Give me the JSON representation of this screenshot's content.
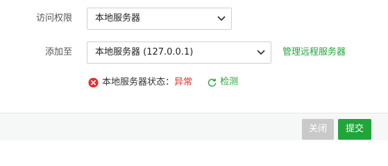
{
  "form": {
    "access": {
      "label": "访问权限",
      "selected": "本地服务器"
    },
    "add_to": {
      "label": "添加至",
      "selected": "本地服务器 (127.0.0.1)",
      "manage_link": "管理远程服务器"
    },
    "status": {
      "label": "本地服务器状态：",
      "value": "异常",
      "detect_label": "检测"
    }
  },
  "footer": {
    "close_label": "关闭",
    "submit_label": "提交"
  },
  "colors": {
    "accent": "#20a53a",
    "error": "#e0322b",
    "disabled": "#c9c9c9"
  },
  "icons": {
    "error": "error-circle-icon",
    "refresh": "refresh-icon",
    "dropdown": "chevron-down-icon"
  }
}
